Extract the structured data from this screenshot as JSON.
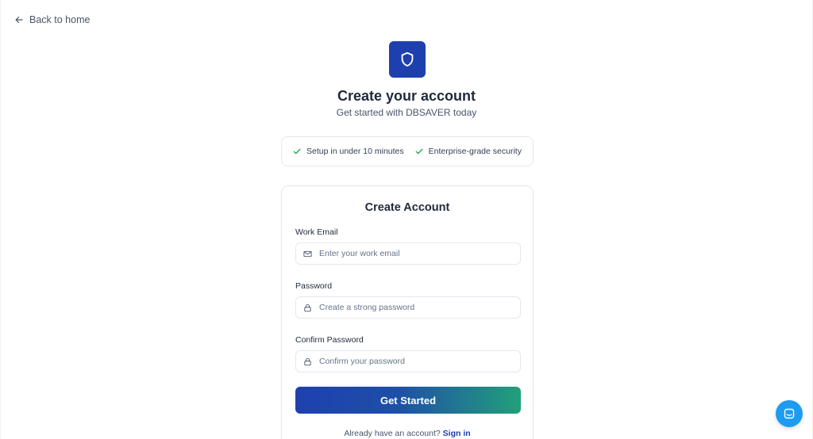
{
  "nav": {
    "back_label": "Back to home"
  },
  "header": {
    "logo_icon": "shield-icon",
    "title": "Create your account",
    "subtitle": "Get started with DBSAVER today"
  },
  "features": [
    {
      "icon": "check-icon",
      "label": "Setup in under 10 minutes"
    },
    {
      "icon": "check-icon",
      "label": "Enterprise-grade security"
    }
  ],
  "form": {
    "title": "Create Account",
    "email": {
      "label": "Work Email",
      "icon": "mail-icon",
      "placeholder": "Enter your work email",
      "value": ""
    },
    "password": {
      "label": "Password",
      "icon": "lock-icon",
      "placeholder": "Create a strong password",
      "value": ""
    },
    "confirm_password": {
      "label": "Confirm Password",
      "icon": "lock-icon",
      "placeholder": "Confirm your password",
      "value": ""
    },
    "submit_label": "Get Started",
    "signin_prompt": "Already have an account?",
    "signin_link": "Sign in"
  },
  "chat": {
    "icon": "chat-icon"
  },
  "colors": {
    "brand": "#1e40af",
    "accent_green": "#22a07a",
    "check": "#16a34a",
    "chat": "#1d9bf0"
  }
}
